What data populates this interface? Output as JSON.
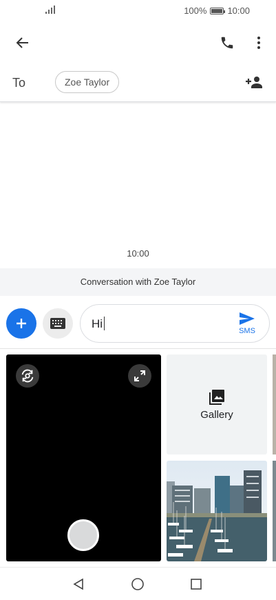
{
  "status_bar": {
    "battery_percent": "100%",
    "time": "10:00"
  },
  "header": {
    "back_icon": "arrow-left-icon",
    "call_icon": "phone-icon",
    "more_icon": "more-vert-icon"
  },
  "recipient": {
    "to_label": "To",
    "chip_name": "Zoe Taylor",
    "add_icon": "add-person-icon"
  },
  "conversation": {
    "timestamp": "10:00",
    "banner": "Conversation with Zoe Taylor"
  },
  "compose": {
    "message_text": "Hi",
    "send_label": "SMS",
    "send_icon": "send-icon",
    "attach_icon": "plus-icon",
    "keyboard_icon": "keyboard-icon"
  },
  "media": {
    "gallery_label": "Gallery",
    "gallery_icon": "photo-library-icon",
    "rotate_icon": "camera-switch-icon",
    "expand_icon": "expand-icon"
  },
  "colors": {
    "accent": "#1a73e8",
    "camera_bg": "#000000",
    "banner_bg": "#f4f5f7"
  }
}
